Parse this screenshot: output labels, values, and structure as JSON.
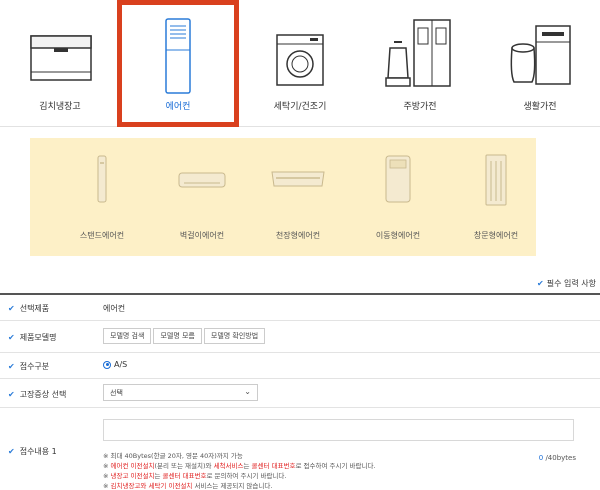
{
  "categories": [
    {
      "label": "김치냉장고",
      "icon": "kimchi-fridge-icon"
    },
    {
      "label": "에어컨",
      "icon": "air-conditioner-icon",
      "selected": true
    },
    {
      "label": "세탁기/건조기",
      "icon": "washing-machine-icon"
    },
    {
      "label": "주방가전",
      "icon": "kitchen-appliance-icon"
    },
    {
      "label": "생활가전",
      "icon": "home-appliance-icon"
    }
  ],
  "subcategories": [
    {
      "label": "스탠드에어컨",
      "icon": "stand-ac-icon"
    },
    {
      "label": "벽걸이에어컨",
      "icon": "wall-ac-icon"
    },
    {
      "label": "천장형에어컨",
      "icon": "ceiling-ac-icon"
    },
    {
      "label": "이동형에어컨",
      "icon": "portable-ac-icon"
    },
    {
      "label": "창문형에어컨",
      "icon": "window-ac-icon"
    }
  ],
  "required_note": "필수 입력 사항",
  "form": {
    "product": {
      "label": "선택제품",
      "value": "에어컨"
    },
    "model": {
      "label": "제품모델명",
      "buttons": [
        "모델명 검색",
        "모델명 모름",
        "모델명 확인방법"
      ]
    },
    "receipt_type": {
      "label": "접수구분",
      "option": "A/S"
    },
    "symptom": {
      "label": "고장증상 선택",
      "selected": "선택"
    },
    "content": {
      "label": "접수내용 1",
      "counter_current": "0",
      "counter_max": "/40bytes",
      "note1": "※ 최대 40Bytes(한글 20자, 영문 40자)까지 가능",
      "note2_a": "※ ",
      "note2_b": "에어컨 이전설치",
      "note2_c": "(분리 또는 재설치)와 ",
      "note2_d": "세척서비스",
      "note2_e": "는 ",
      "note2_f": "콜센터 대표번호",
      "note2_g": "로 접수하여 주시기 바랍니다.",
      "note3_a": "※ ",
      "note3_b": "냉장고 이전설치",
      "note3_c": "는 ",
      "note3_d": "콜센터 대표번호",
      "note3_e": "로 문의하여 주시기 바랍니다.",
      "note4_a": "※ ",
      "note4_b": "김치냉장고와 세탁기 이전설치",
      "note4_c": " 서비스는 제공되지 않습니다."
    }
  },
  "colors": {
    "selected_border": "#d9401e",
    "accent_blue": "#1a6dd6",
    "panel_bg": "#fdf0c7",
    "warning_red": "#e02020"
  }
}
